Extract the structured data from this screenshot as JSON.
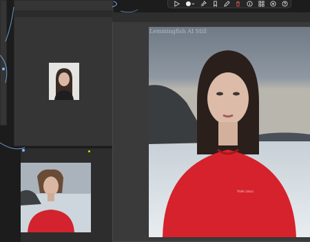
{
  "canvas": {
    "background": "#1c1c1c",
    "node_color": "#353535",
    "link_color": "#7fb4ff",
    "accent_dot": "#e6d400"
  },
  "toolbar": {
    "items": [
      {
        "icon": "play-icon"
      },
      {
        "icon": "circle-dropdown-icon"
      },
      {
        "icon": "pin-icon"
      },
      {
        "icon": "bookmark-icon"
      },
      {
        "icon": "pencil-icon"
      },
      {
        "icon": "trash-icon",
        "color": "#e0524f"
      },
      {
        "icon": "info-icon"
      },
      {
        "icon": "apps-icon"
      },
      {
        "icon": "settings-circle-icon"
      },
      {
        "icon": "help-icon"
      }
    ]
  },
  "preview_node": {
    "watermark": "Lemmingfish AI Still",
    "shirt_text": "Yuki (ma)"
  }
}
